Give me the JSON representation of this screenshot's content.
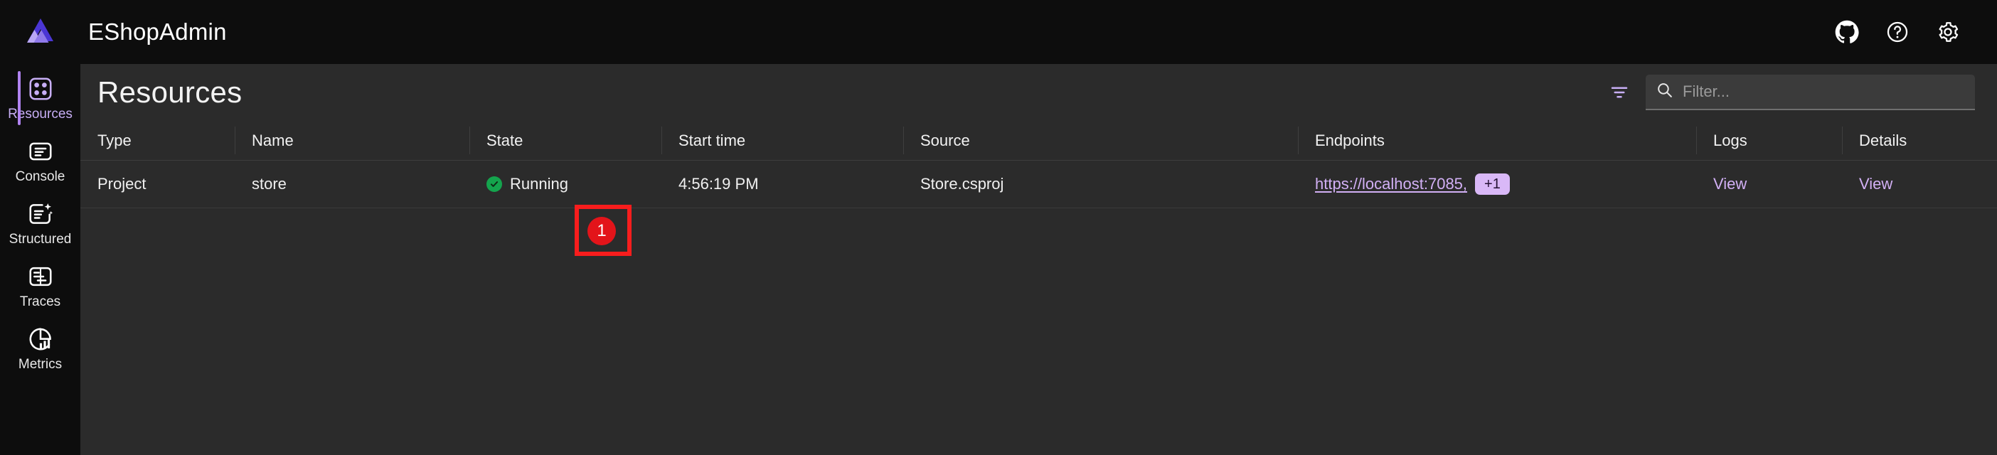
{
  "header": {
    "app_title": "EShopAdmin",
    "logo_icon": "aspire-logo-icon",
    "actions": [
      {
        "name": "github-icon",
        "label": "GitHub"
      },
      {
        "name": "help-icon",
        "label": "Help"
      },
      {
        "name": "settings-gear-icon",
        "label": "Settings"
      }
    ]
  },
  "sidebar": {
    "items": [
      {
        "label": "Resources",
        "icon": "resources-grid-icon",
        "active": true
      },
      {
        "label": "Console",
        "icon": "console-lines-icon",
        "active": false
      },
      {
        "label": "Structured",
        "icon": "structured-logs-icon",
        "active": false
      },
      {
        "label": "Traces",
        "icon": "traces-icon",
        "active": false
      },
      {
        "label": "Metrics",
        "icon": "metrics-piechart-icon",
        "active": false
      }
    ]
  },
  "main": {
    "page_title": "Resources",
    "filter_icon": "filter-icon",
    "search": {
      "icon": "search-icon",
      "placeholder": "Filter...",
      "value": ""
    },
    "table": {
      "columns": [
        "Type",
        "Name",
        "State",
        "Start time",
        "Source",
        "Endpoints",
        "Logs",
        "Details"
      ],
      "rows": [
        {
          "type": "Project",
          "name": "store",
          "state": "Running",
          "state_icon": "check-circle-icon",
          "state_color": "#14a44d",
          "start_time": "4:56:19 PM",
          "source": "Store.csproj",
          "endpoint_url": "https://localhost:7085,",
          "endpoint_more": "+1",
          "logs": "View",
          "details": "View"
        }
      ]
    }
  },
  "annotation": {
    "marker_number": "1",
    "box_color": "#f81d1d",
    "badge_color": "#e3141a"
  },
  "theme": {
    "background": "#0d0d0d",
    "panel": "#2b2b2b",
    "accent": "#b083f0",
    "link": "#d2b0f5"
  }
}
